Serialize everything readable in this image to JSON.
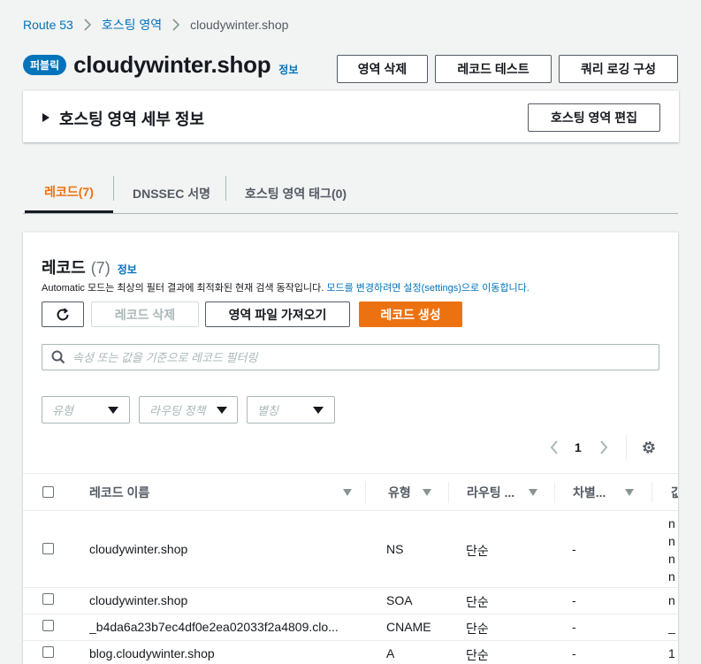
{
  "breadcrumb": {
    "items": [
      "Route 53",
      "호스팅 영역",
      "cloudywinter.shop"
    ]
  },
  "header": {
    "badge": "퍼블릭",
    "title": "cloudywinter.shop",
    "info": "정보",
    "buttons": {
      "delete_zone": "영역 삭제",
      "test_record": "레코드 테스트",
      "query_logging": "쿼리 로깅 구성"
    }
  },
  "details": {
    "title": "호스팅 영역 세부 정보",
    "edit_button": "호스팅 영역 편집"
  },
  "tabs": [
    {
      "label": "레코드(7)",
      "active": true
    },
    {
      "label": "DNSSEC 서명",
      "active": false
    },
    {
      "label": "호스팅 영역 태그(0)",
      "active": false
    }
  ],
  "records": {
    "title": "레코드",
    "count": "(7)",
    "info": "정보",
    "description_prefix": "Automatic 모드는 최상의 필터 결과에 최적화된 현재 검색 동작입니다.",
    "description_link": "모드를 변경하려면 설정(settings)으로 이동합니다.",
    "buttons": {
      "delete": "레코드 삭제",
      "import": "영역 파일 가져오기",
      "create": "레코드 생성"
    },
    "search_placeholder": "속성 또는 값을 기준으로 레코드 필터링",
    "filters": {
      "type": "유형",
      "routing": "라우팅 정책",
      "alias": "별칭"
    },
    "pagination": {
      "page": "1"
    },
    "columns": [
      "레코드 이름",
      "유형",
      "라우팅 ...",
      "차별...",
      "값"
    ],
    "rows": [
      {
        "name": "cloudywinter.shop",
        "type": "NS",
        "routing": "단순",
        "diff": "-",
        "values": [
          "n",
          "n",
          "n",
          "n"
        ]
      },
      {
        "name": "cloudywinter.shop",
        "type": "SOA",
        "routing": "단순",
        "diff": "-",
        "values": [
          "n"
        ]
      },
      {
        "name": "_b4da6a23b7ec4df0e2ea02033f2a4809.clo...",
        "type": "CNAME",
        "routing": "단순",
        "diff": "-",
        "values": [
          "_"
        ]
      },
      {
        "name": "blog.cloudywinter.shop",
        "type": "A",
        "routing": "단순",
        "diff": "-",
        "values": [
          "1"
        ]
      }
    ]
  },
  "colors": {
    "link": "#0073bb",
    "primary": "#ec7211",
    "text": "#16191f"
  }
}
